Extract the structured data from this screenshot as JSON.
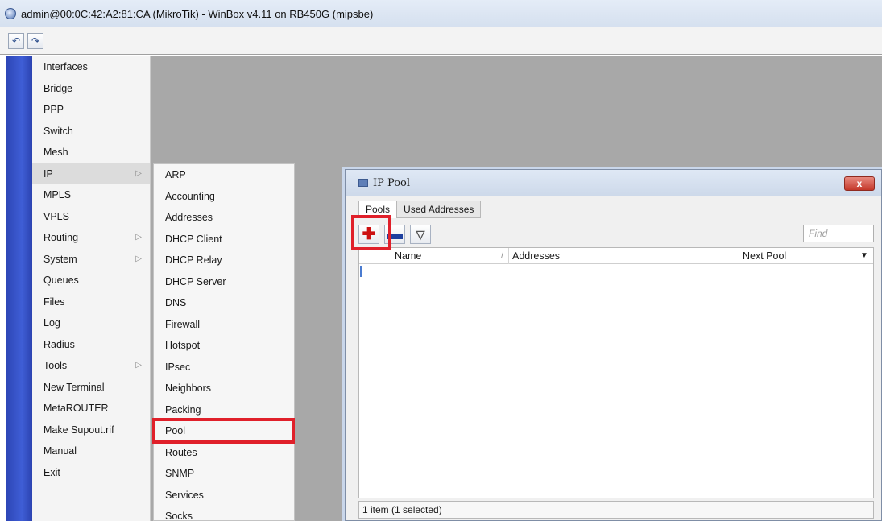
{
  "window": {
    "title": "admin@00:0C:42:A2:81:CA (MikroTik) - WinBox v4.11 on RB450G (mipsbe)"
  },
  "toolbar": {
    "undo_icon": "undo-icon",
    "redo_icon": "redo-icon"
  },
  "menu": {
    "items": [
      {
        "label": "Interfaces"
      },
      {
        "label": "Bridge"
      },
      {
        "label": "PPP"
      },
      {
        "label": "Switch"
      },
      {
        "label": "Mesh"
      },
      {
        "label": "IP",
        "submenu": true
      },
      {
        "label": "MPLS"
      },
      {
        "label": "VPLS"
      },
      {
        "label": "Routing",
        "submenu": true
      },
      {
        "label": "System",
        "submenu": true
      },
      {
        "label": "Queues"
      },
      {
        "label": "Files"
      },
      {
        "label": "Log"
      },
      {
        "label": "Radius"
      },
      {
        "label": "Tools",
        "submenu": true
      },
      {
        "label": "New Terminal"
      },
      {
        "label": "MetaROUTER"
      },
      {
        "label": "Make Supout.rif"
      },
      {
        "label": "Manual"
      },
      {
        "label": "Exit"
      }
    ]
  },
  "submenu": {
    "items": [
      {
        "label": "ARP"
      },
      {
        "label": "Accounting"
      },
      {
        "label": "Addresses"
      },
      {
        "label": "DHCP Client"
      },
      {
        "label": "DHCP Relay"
      },
      {
        "label": "DHCP Server"
      },
      {
        "label": "DNS"
      },
      {
        "label": "Firewall"
      },
      {
        "label": "Hotspot"
      },
      {
        "label": "IPsec"
      },
      {
        "label": "Neighbors"
      },
      {
        "label": "Packing"
      },
      {
        "label": "Pool"
      },
      {
        "label": "Routes"
      },
      {
        "label": "SNMP"
      },
      {
        "label": "Services"
      },
      {
        "label": "Socks"
      }
    ],
    "highlighted": "Pool"
  },
  "pool_window": {
    "title": "IP Pool",
    "close_label": "x",
    "tabs": [
      {
        "label": "Pools",
        "active": true
      },
      {
        "label": "Used Addresses",
        "active": false
      }
    ],
    "find_placeholder": "Find",
    "columns": {
      "name": "Name",
      "addresses": "Addresses",
      "next_pool": "Next Pool"
    },
    "status": "1 item (1 selected)"
  },
  "colors": {
    "highlight": "#e0202a",
    "menu_strip": "#3f5ed6",
    "workspace": "#a8a8a8"
  }
}
